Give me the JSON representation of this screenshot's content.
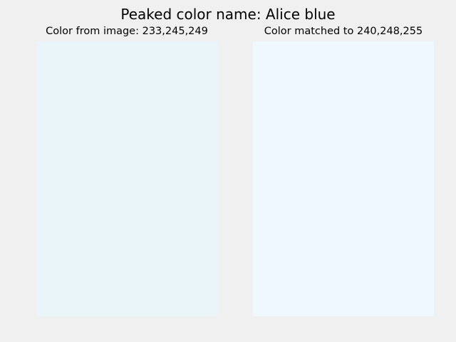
{
  "title": "Peaked color name: Alice blue",
  "panels": [
    {
      "title": "Color from image: 233,245,249",
      "swatch_color": "#e9f5f9"
    },
    {
      "title": "Color matched to 240,248,255",
      "swatch_color": "#f0f8ff"
    }
  ],
  "colors": {
    "background": "#f0f0f0",
    "text": "#000000"
  }
}
